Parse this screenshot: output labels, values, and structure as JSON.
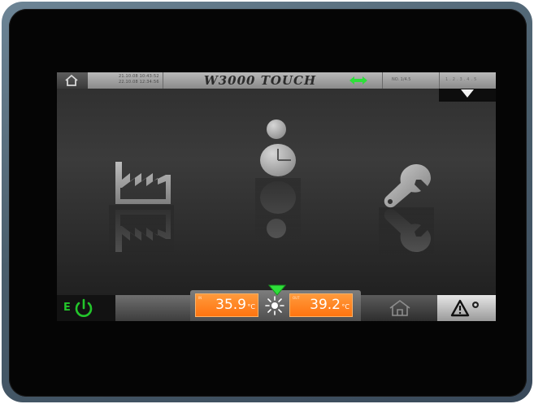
{
  "device": {
    "title": "W3000 TOUCH"
  },
  "topbar": {
    "date_line1": "21.10.08 10:43:52",
    "date_line2": "22.10.08 12:34:56",
    "status_a": "NO. 1/4.5",
    "status_b": "1.2.3.4.5"
  },
  "menu": {
    "items": [
      {
        "name": "factory",
        "icon": "factory-icon"
      },
      {
        "name": "user",
        "icon": "user-icon"
      },
      {
        "name": "service",
        "icon": "wrench-icon"
      }
    ]
  },
  "bottombar": {
    "power_label": "E",
    "inlet": {
      "tag": "IN",
      "value": "35.9",
      "unit": "°C"
    },
    "outlet": {
      "tag": "OUT",
      "value": "39.2",
      "unit": "°C"
    }
  },
  "colors": {
    "accent_green": "#23c52b",
    "temp_orange": "#ff8022",
    "alarm_white": "#ffffff"
  }
}
